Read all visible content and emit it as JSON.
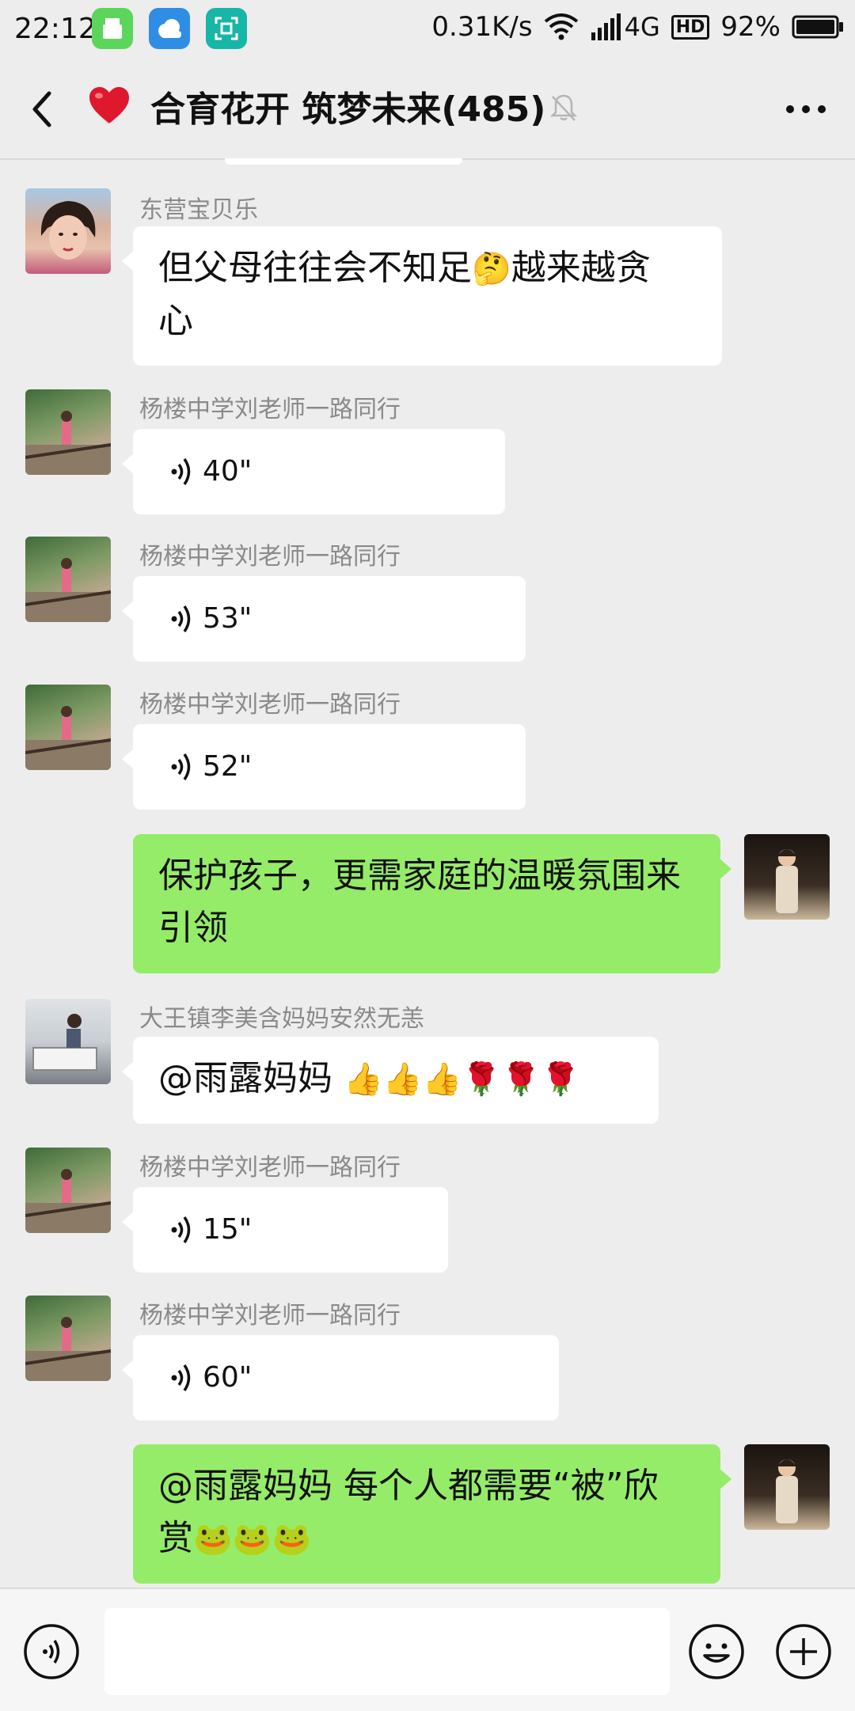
{
  "status_bar": {
    "time": "22:12",
    "speed": "0.31K/s",
    "network": "4G",
    "hd": "HD",
    "battery": "92%"
  },
  "header": {
    "title": "合育花开 筑梦未来(485)"
  },
  "messages": [
    {
      "sender": "东营宝贝乐",
      "line1": "但父母往往会不知足",
      "emoji": "🤔",
      "line1b": "越来越贪",
      "line2": "心"
    },
    {
      "sender": "杨楼中学刘老师一路同行",
      "duration": "40\""
    },
    {
      "sender": "杨楼中学刘老师一路同行",
      "duration": "53\""
    },
    {
      "sender": "杨楼中学刘老师一路同行",
      "duration": "52\""
    },
    {
      "line1": "保护孩子，更需家庭的温暖氛围来",
      "line2": "引领"
    },
    {
      "sender": "大王镇李美含妈妈安然无恙",
      "text": "@雨露妈妈 ",
      "emoji": "👍👍👍🌹🌹🌹"
    },
    {
      "sender": "杨楼中学刘老师一路同行",
      "duration": "15\""
    },
    {
      "sender": "杨楼中学刘老师一路同行",
      "duration": "60\""
    },
    {
      "line1": "@雨露妈妈  每个人都需要“被”欣",
      "line2": "赏",
      "emoji": "🐸🐸🐸"
    }
  ],
  "colors": {
    "background": "#ededed",
    "outgoing_bubble": "#95ec69",
    "incoming_bubble": "#ffffff",
    "sender_name": "#8a8a8a"
  }
}
